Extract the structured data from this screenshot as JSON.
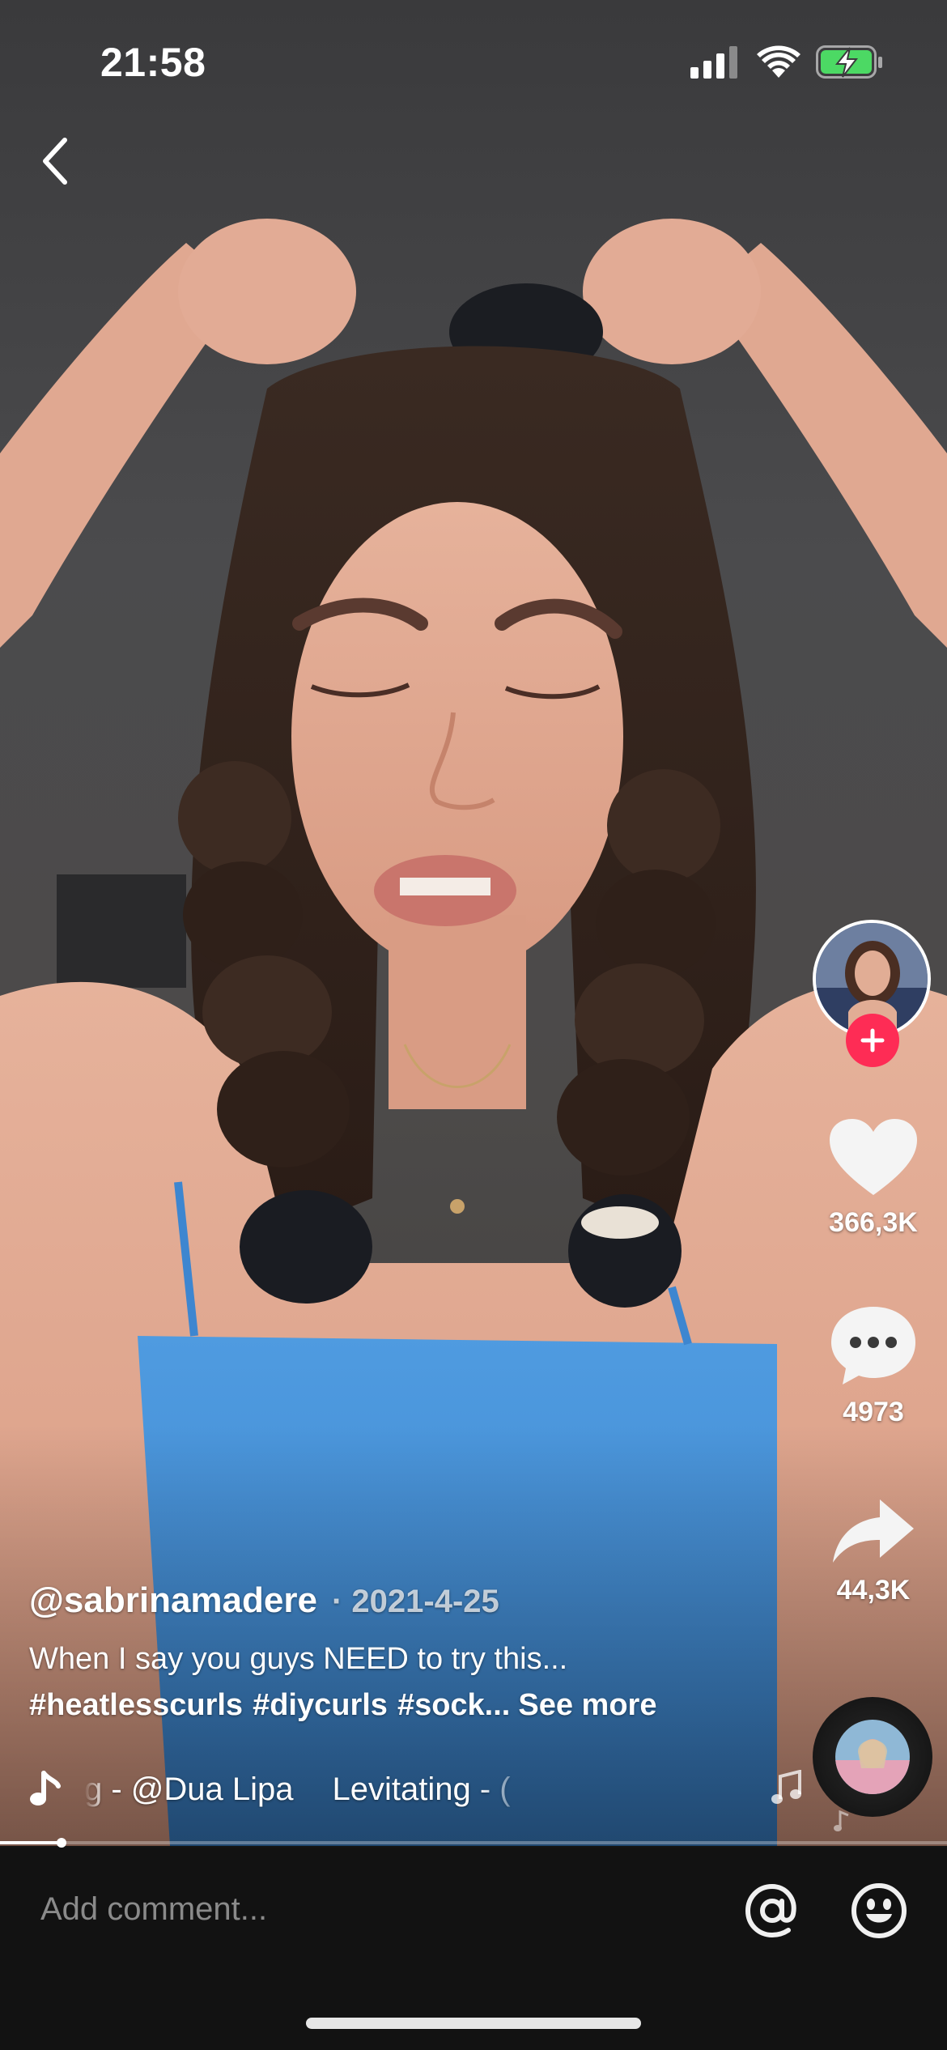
{
  "status_bar": {
    "time": "21:58",
    "icons": [
      "signal-icon",
      "wifi-icon",
      "battery-charging-icon"
    ],
    "battery_color": "#4cd964"
  },
  "nav": {
    "back_icon": "chevron-left-icon"
  },
  "creator": {
    "avatar_icon": "profile-avatar",
    "follow_icon": "plus-icon",
    "follow_color": "#fe2c55"
  },
  "actions": {
    "likes": "366,3K",
    "comments": "4973",
    "shares": "44,3K"
  },
  "caption": {
    "author": "@sabrinamadere",
    "date": "· 2021-4-25",
    "text": "When I say you guys NEED to try this...",
    "hashtags": [
      "#heatlesscurls",
      "#diycurls",
      "#sock..."
    ],
    "see_more": "See more"
  },
  "music": {
    "icon": "music-note-icon",
    "marquee_left": "g - @Dua Lipa",
    "marquee_right": "Levitating - ("
  },
  "progress": {
    "fraction": 0.065
  },
  "comment_bar": {
    "placeholder": "Add comment...",
    "mention_icon": "at-sign-icon",
    "emoji_icon": "emoji-icon"
  }
}
